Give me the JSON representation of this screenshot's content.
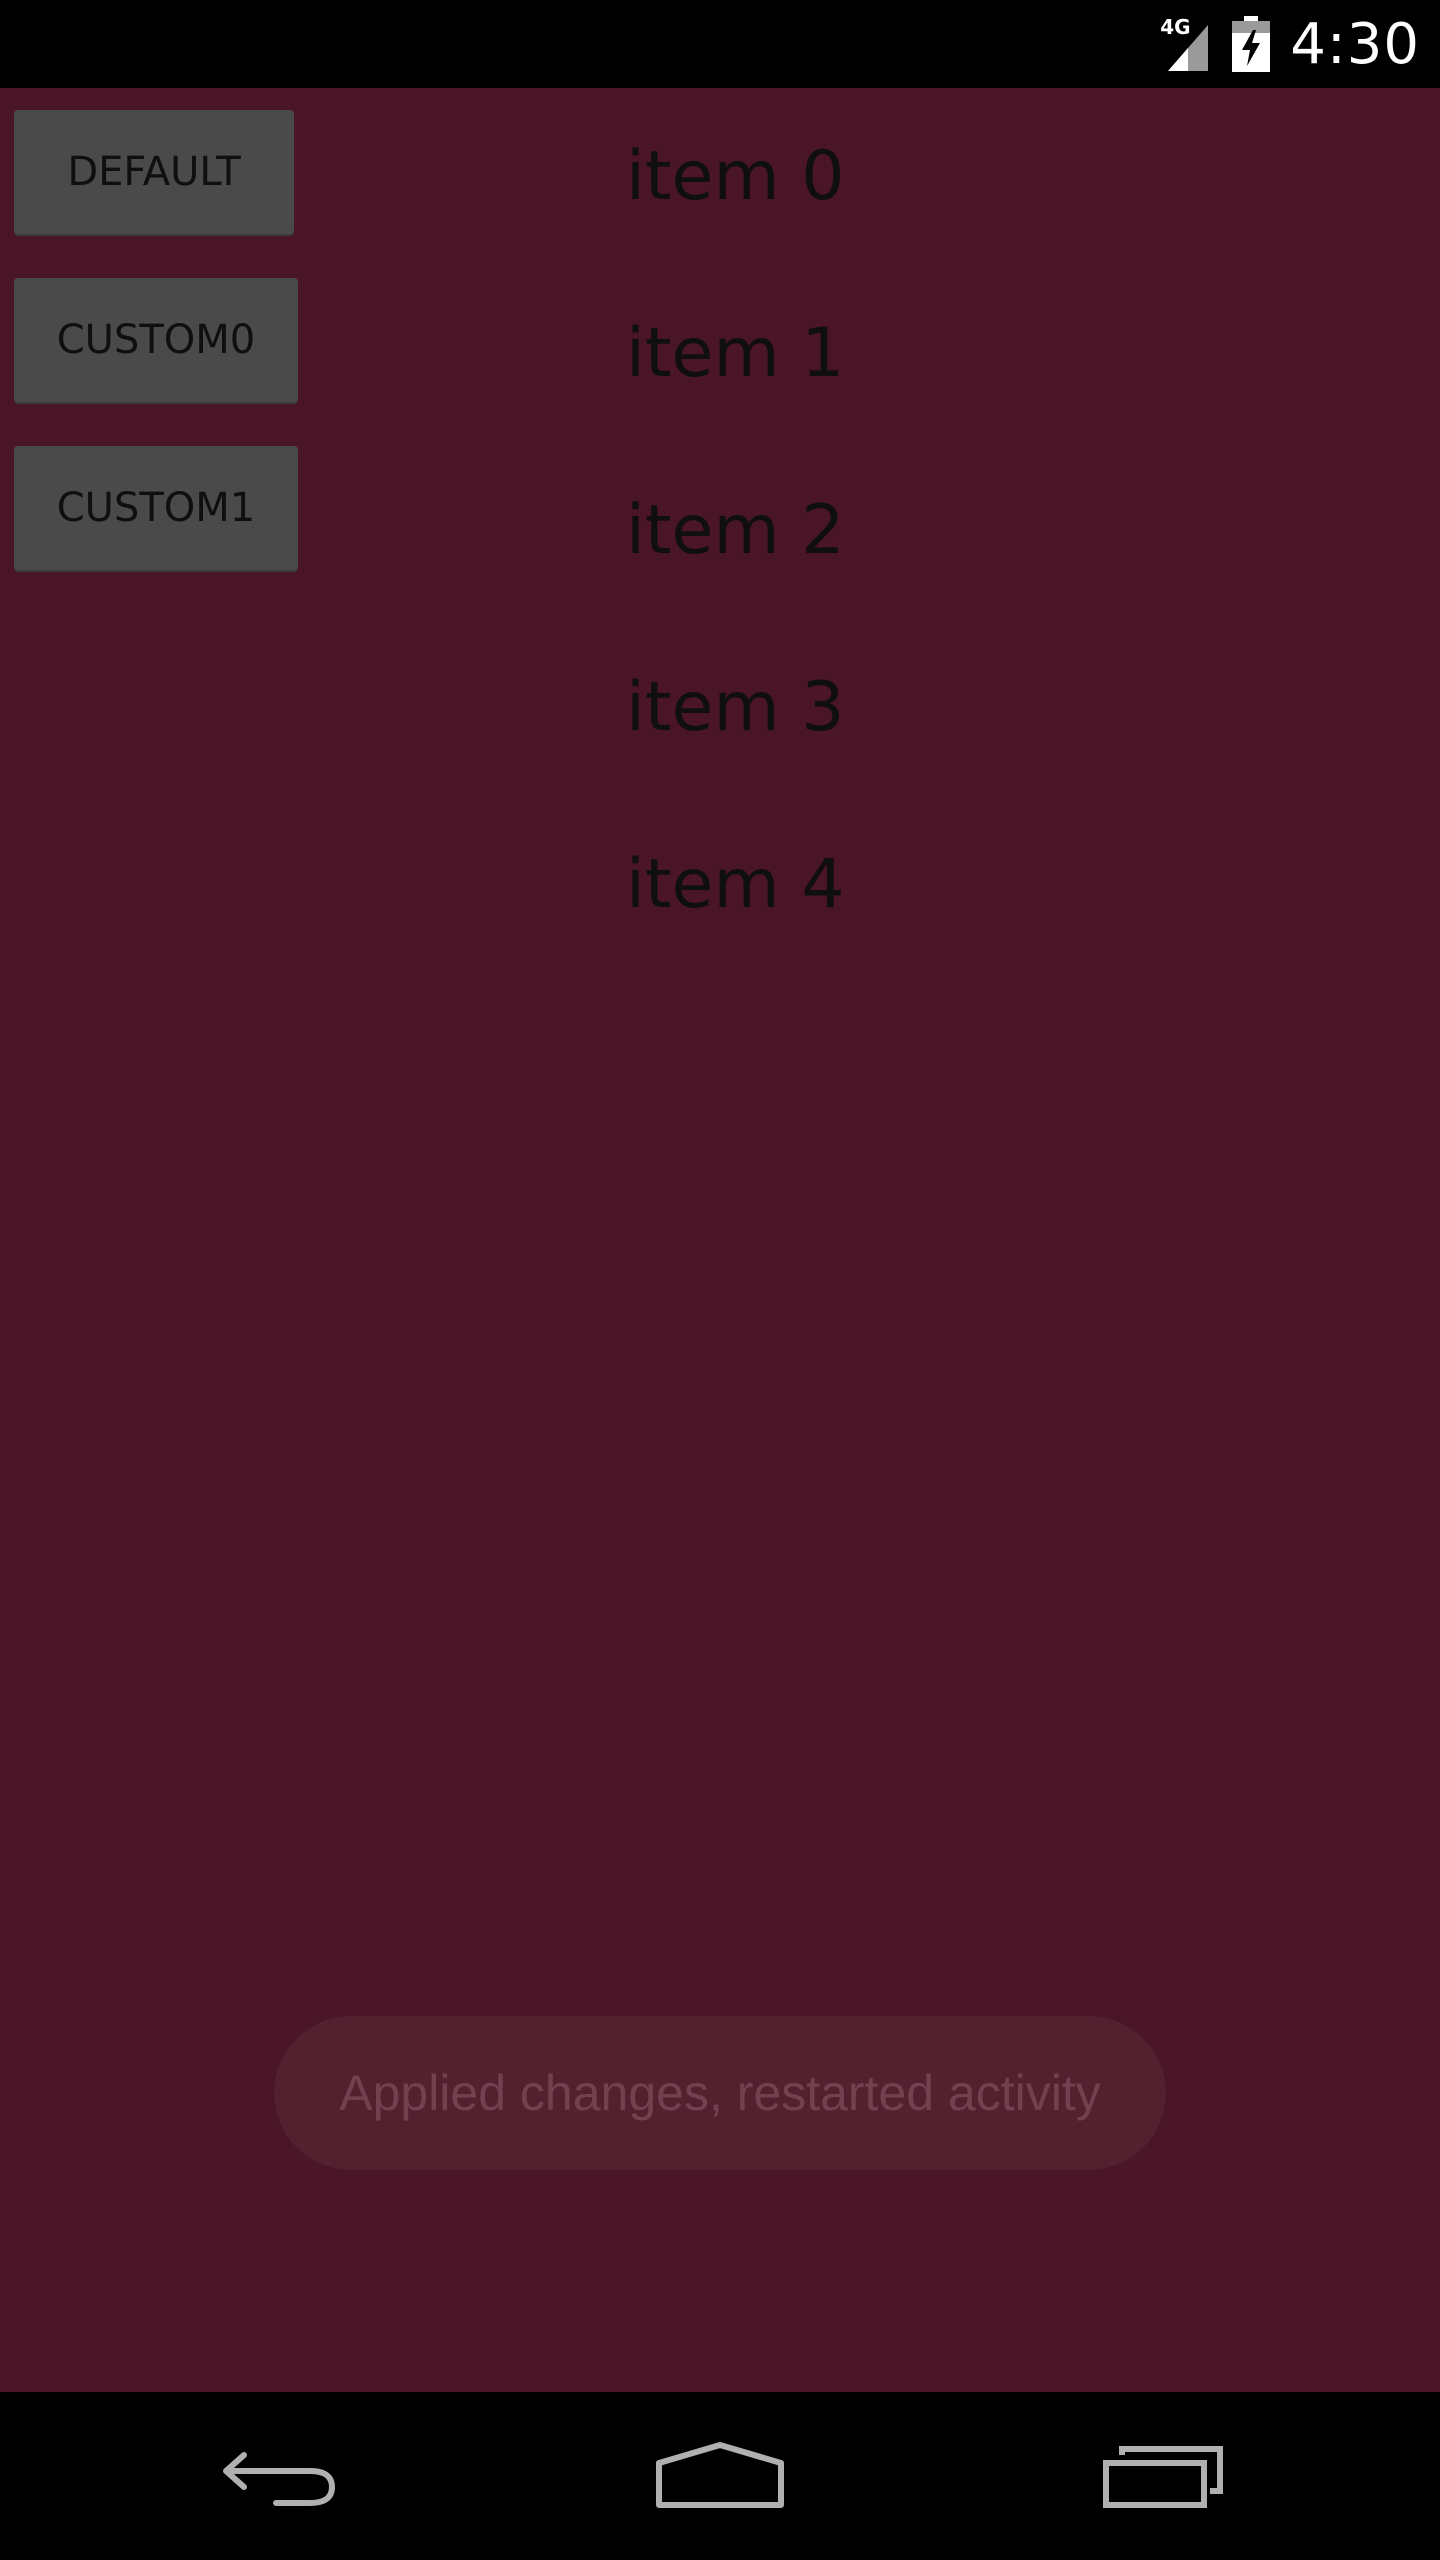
{
  "status_bar": {
    "network_label": "4G",
    "time": "4:30",
    "icons": [
      "signal-icon",
      "battery-charging-icon"
    ]
  },
  "buttons": {
    "default_label": "DEFAULT",
    "custom0_label": "CUSTOM0",
    "custom1_label": "CUSTOM1"
  },
  "list": {
    "items": [
      "item 0",
      "item 1",
      "item 2",
      "item 3",
      "item 4"
    ]
  },
  "toast": {
    "message": "Applied changes, restarted activity"
  },
  "nav_bar": {
    "icons": [
      "back-icon",
      "home-icon",
      "recents-icon"
    ]
  },
  "colors": {
    "background": "#4a1526",
    "button": "#4a4a4a",
    "toast_bg": "#52202f",
    "toast_text": "#73404f"
  }
}
